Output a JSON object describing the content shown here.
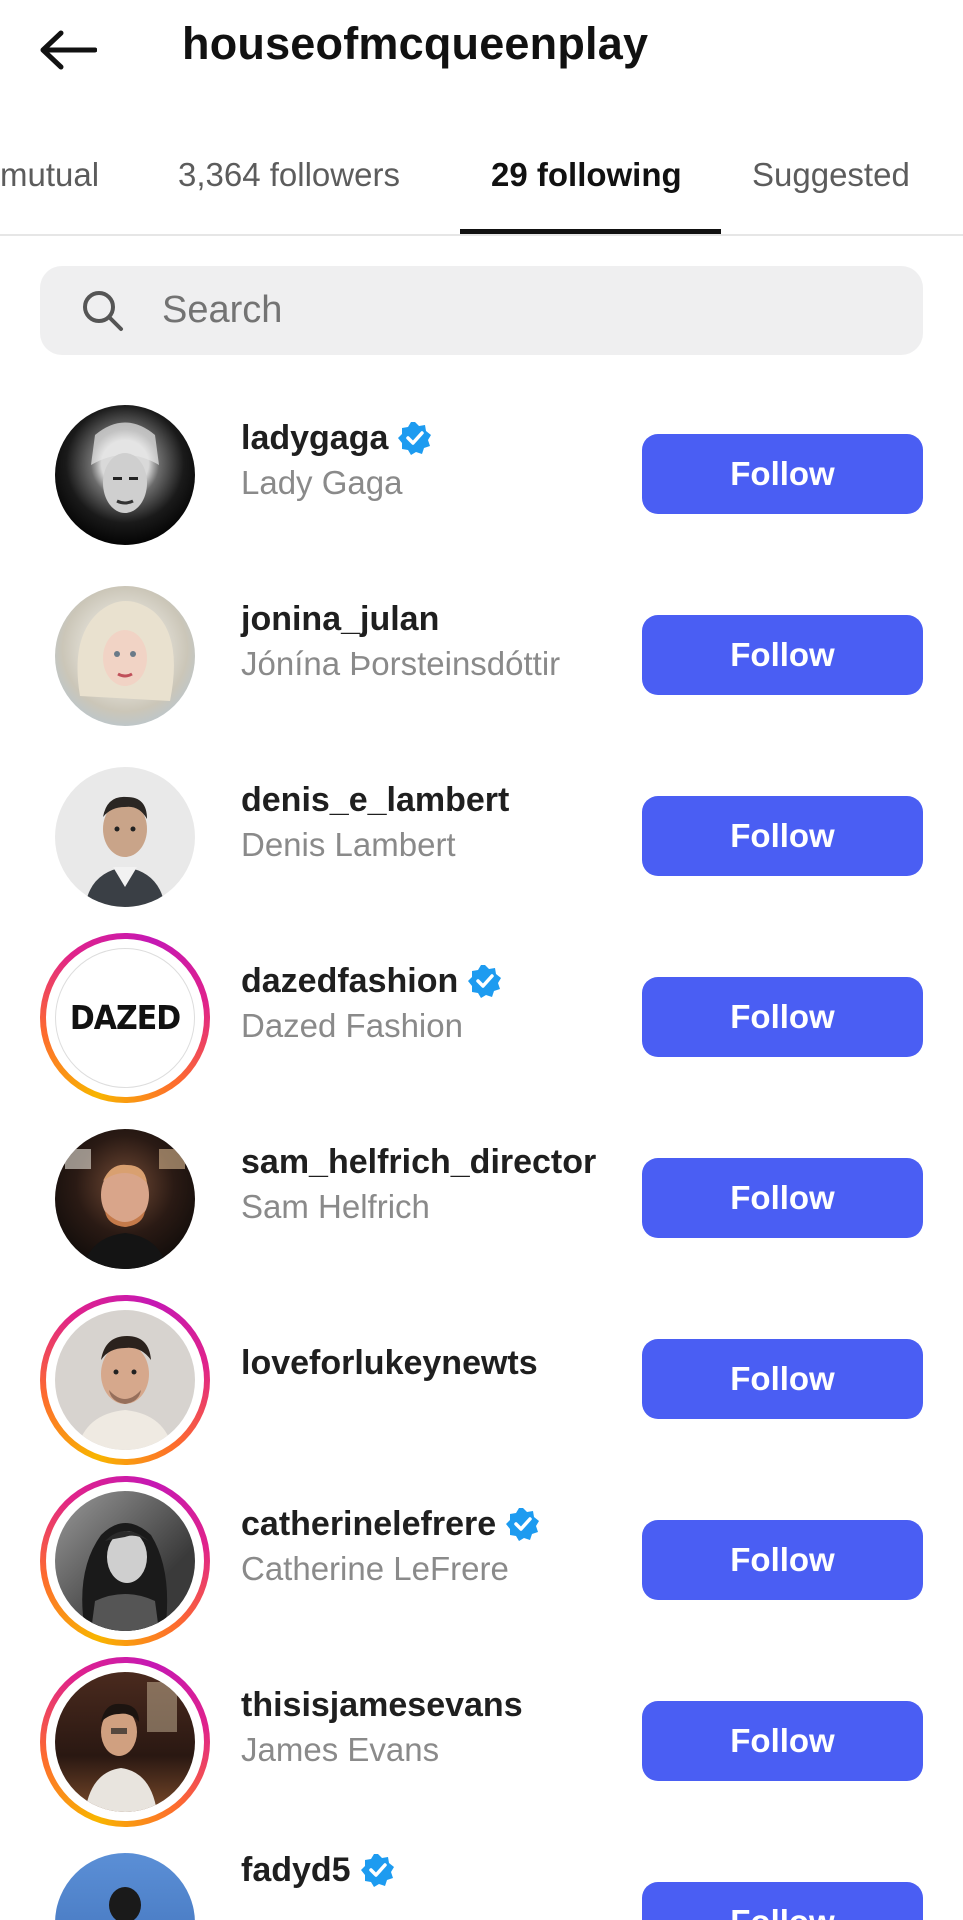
{
  "header": {
    "title": "houseofmcqueenplay",
    "back_icon": "arrow-left-icon"
  },
  "tabs": [
    {
      "label": "mutual",
      "active": false
    },
    {
      "label": "3,364 followers",
      "active": false
    },
    {
      "label": "29 following",
      "active": true
    },
    {
      "label": "Suggested",
      "active": false
    }
  ],
  "search": {
    "placeholder": "Search",
    "value": "",
    "icon": "search-icon"
  },
  "users": [
    {
      "username": "ladygaga",
      "fullname": "Lady Gaga",
      "verified": true,
      "story_ring": false,
      "button": "Follow"
    },
    {
      "username": "jonina_julan",
      "fullname": "Jónína Þorsteinsdóttir",
      "verified": false,
      "story_ring": false,
      "button": "Follow"
    },
    {
      "username": "denis_e_lambert",
      "fullname": "Denis Lambert",
      "verified": false,
      "story_ring": false,
      "button": "Follow"
    },
    {
      "username": "dazedfashion",
      "fullname": "Dazed Fashion",
      "verified": true,
      "story_ring": true,
      "button": "Follow",
      "avatar_text": "DAZED"
    },
    {
      "username": "sam_helfrich_director",
      "fullname": "Sam Helfrich",
      "verified": false,
      "story_ring": false,
      "button": "Follow"
    },
    {
      "username": "loveforlukeynewts",
      "fullname": "",
      "verified": false,
      "story_ring": true,
      "button": "Follow"
    },
    {
      "username": "catherinelefrere",
      "fullname": "Catherine LeFrere",
      "verified": true,
      "story_ring": true,
      "button": "Follow"
    },
    {
      "username": "thisisjamesevans",
      "fullname": "James Evans",
      "verified": false,
      "story_ring": true,
      "button": "Follow"
    },
    {
      "username": "fadyd5",
      "fullname": "",
      "verified": true,
      "story_ring": false,
      "button": "Follow"
    }
  ],
  "colors": {
    "accent": "#4a5ef3",
    "verified": "#1d9bf0",
    "secondary_text": "#8a8a8a"
  }
}
